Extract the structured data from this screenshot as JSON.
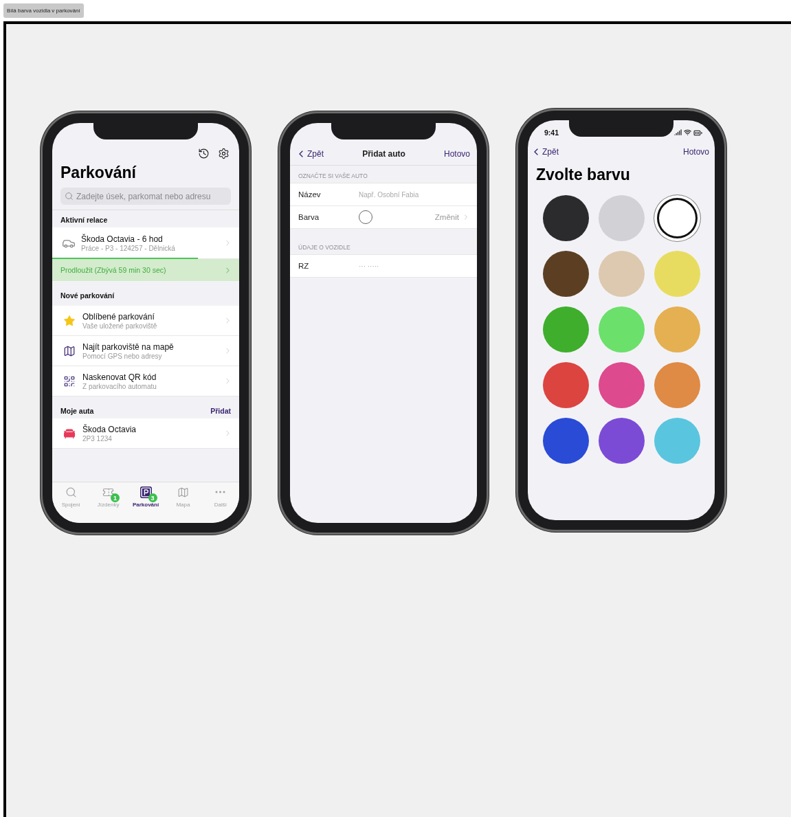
{
  "caption": "Bílá barva vozidla v parkování",
  "parking_screen": {
    "title": "Parkování",
    "search": {
      "placeholder": "Zadejte úsek, parkomat nebo adresu"
    },
    "active_session": {
      "header": "Aktivní relace",
      "title": "Škoda Octavia - 6 hod",
      "subtitle": "Práce - P3 - 124257 - Dělnická",
      "level": 0.78,
      "extend": "Prodloužit (Zbývá 59 min 30 sec)"
    },
    "new_parking": {
      "header": "Nové parkování",
      "items": [
        {
          "kind": "star",
          "title": "Oblíbené parkování",
          "subtitle": "Vaše uložené parkoviště"
        },
        {
          "kind": "map",
          "title": "Najít parkoviště na mapě",
          "subtitle": "Pomocí GPS nebo adresy"
        },
        {
          "kind": "qr",
          "title": "Naskenovat QR kód",
          "subtitle": "Z parkovacího automatu"
        }
      ]
    },
    "my_cars": {
      "header": "Moje auta",
      "action": "Přidat",
      "items": [
        {
          "title": "Škoda Octavia",
          "subtitle": "2P3 1234",
          "color": "#e8395a"
        }
      ]
    },
    "tabs": [
      {
        "kind": "search",
        "label": "Spojení",
        "selected": false
      },
      {
        "kind": "ticket",
        "label": "Jízdenky",
        "selected": false,
        "badge": "1"
      },
      {
        "kind": "parking",
        "label": "Parkování",
        "selected": true,
        "badge": "3"
      },
      {
        "kind": "map",
        "label": "Mapa",
        "selected": false
      },
      {
        "kind": "more",
        "label": "Další",
        "selected": false
      }
    ]
  },
  "add_car_screen": {
    "back": "Zpět",
    "title": "Přidat auto",
    "done": "Hotovo",
    "sections": [
      {
        "header": "OZNAČTE SI VAŠE AUTO",
        "rows": [
          {
            "kind": "input",
            "label": "Název",
            "placeholder": "Např. Osobní Fabia"
          },
          {
            "kind": "color",
            "label": "Barva",
            "color": "#ffffff",
            "action": "Změnit"
          }
        ]
      },
      {
        "header": "ÚDAJE O VOZIDLE",
        "rows": [
          {
            "kind": "input",
            "label": "RZ",
            "placeholder": "··· ·····"
          }
        ]
      }
    ]
  },
  "color_screen": {
    "time": "9:41",
    "back": "Zpět",
    "done": "Hotovo",
    "title": "Zvolte barvu",
    "colors": [
      {
        "color": "#2b2b2d",
        "selected": false
      },
      {
        "color": "#d1d1d6",
        "selected": false
      },
      {
        "color": "#ffffff",
        "selected": true
      },
      {
        "color": "#5c3f22",
        "selected": false
      },
      {
        "color": "#ddc9b0",
        "selected": false
      },
      {
        "color": "#e8dc60",
        "selected": false
      },
      {
        "color": "#3fae2c",
        "selected": false
      },
      {
        "color": "#6be06b",
        "selected": false
      },
      {
        "color": "#e5b052",
        "selected": false
      },
      {
        "color": "#dc4440",
        "selected": false
      },
      {
        "color": "#dd4a8e",
        "selected": false
      },
      {
        "color": "#df8a45",
        "selected": false
      },
      {
        "color": "#2a4bd6",
        "selected": false
      },
      {
        "color": "#7b4bd6",
        "selected": false
      },
      {
        "color": "#5ac5df",
        "selected": false
      }
    ]
  }
}
